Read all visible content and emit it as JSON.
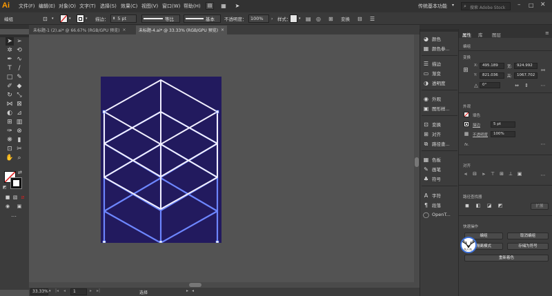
{
  "app": {
    "logo": "Ai",
    "menu": [
      "文件(F)",
      "编辑(E)",
      "对象(O)",
      "文字(T)",
      "选择(S)",
      "效果(C)",
      "视图(V)",
      "窗口(W)",
      "帮助(H)"
    ],
    "workspace": "传统基本功能",
    "search_placeholder": "搜索 Adobe Stock"
  },
  "controlbar": {
    "mode_label": "编组",
    "stroke_label": "描边：",
    "stroke_value": "5 pt",
    "profile_label": "等比",
    "brush_label": "基本",
    "opacity_label": "不透明度：",
    "opacity_value": "100%",
    "style_label": "样式：",
    "transform_label": "变换"
  },
  "tabs": [
    {
      "label": "未标题-1 (2).ai* @ 66.67% (RGB/GPU 预览)",
      "active": false
    },
    {
      "label": "未标题-4.ai* @ 33.33% (RGB/GPU 预览)",
      "active": true
    }
  ],
  "status": {
    "zoom": "33.33%",
    "page": "1",
    "tool": "选择"
  },
  "dock": {
    "items": [
      "颜色",
      "颜色参...",
      "描边",
      "渐变",
      "透明度",
      "外观",
      "图形样...",
      "变换",
      "对齐",
      "路径查...",
      "色板",
      "画笔",
      "符号",
      "字符",
      "段落",
      "OpenT..."
    ]
  },
  "properties": {
    "tabs": [
      "属性",
      "库",
      "图层"
    ],
    "group_label": "编组",
    "transform_title": "变换",
    "x_label": "X:",
    "x_value": "495.189",
    "y_label": "Y:",
    "y_value": "821.036",
    "w_label": "宽:",
    "w_value": "924.992",
    "h_label": "高:",
    "h_value": "1067.702",
    "angle_value": "0°",
    "appearance_title": "外观",
    "fill_label": "填色",
    "stroke_label": "描边",
    "stroke_value": "5 pt",
    "opacity_label": "不透明度",
    "opacity_value": "100%",
    "fx_label": "fx.",
    "align_title": "对齐",
    "pathfinder_title": "路径查找器",
    "expand_label": "扩展",
    "quick_title": "快速操作",
    "btn_edit": "编组",
    "btn_ungroup": "取消编组",
    "btn_isolate": "隔离模式",
    "btn_save_symbol": "存储为符号",
    "btn_recolor": "重新着色",
    "watermark_text": "鸟人鸟"
  },
  "colors": {
    "artboard": "#221a5e",
    "white_line": "#f2f0ff",
    "blue_line": "#6d86ff",
    "accent_orange": "#ff9a00"
  }
}
